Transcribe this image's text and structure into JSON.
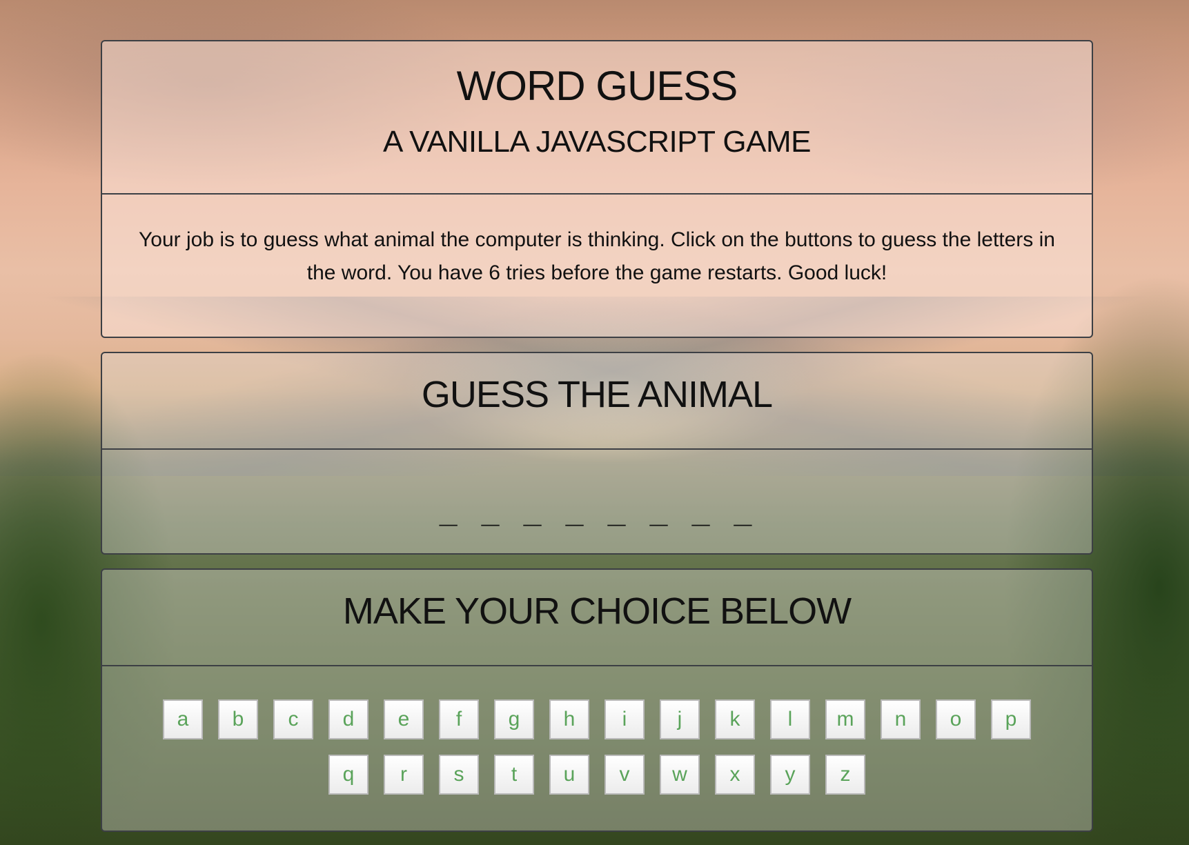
{
  "header": {
    "title": "WORD GUESS",
    "subtitle": "A VANILLA JAVASCRIPT GAME"
  },
  "instructions": {
    "text": "Your job is to guess what animal the computer is thinking. Click on the buttons to guess the letters in the word. You have 6 tries before the game restarts. Good luck!"
  },
  "guess_section": {
    "heading": "GUESS THE ANIMAL",
    "word_display": "_ _ _ _ _ _ _ _"
  },
  "choice_section": {
    "heading": "MAKE YOUR CHOICE BELOW",
    "row1": [
      "a",
      "b",
      "c",
      "d",
      "e",
      "f",
      "g",
      "h",
      "i",
      "j",
      "k",
      "l",
      "m",
      "n",
      "o",
      "p"
    ],
    "row2": [
      "q",
      "r",
      "s",
      "t",
      "u",
      "v",
      "w",
      "x",
      "y",
      "z"
    ]
  },
  "colors": {
    "letter_text": "#5aa35a",
    "panel_border": "#3c3f44"
  }
}
